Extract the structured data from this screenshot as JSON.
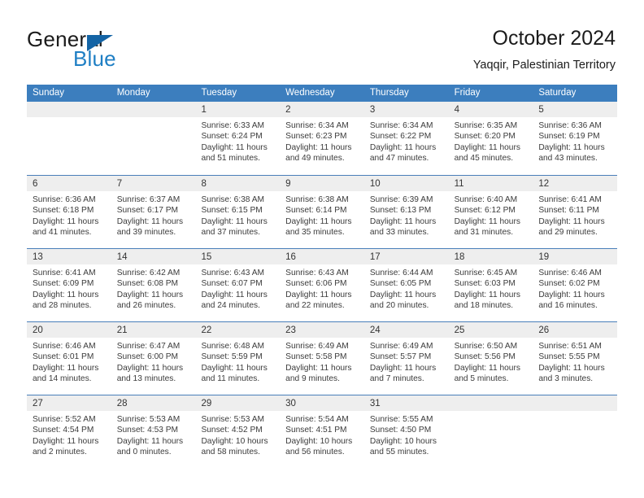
{
  "branding": {
    "name_primary": "General",
    "name_secondary": "Blue",
    "triangle_color": "#1464a5",
    "secondary_color": "#1f7fc4"
  },
  "header": {
    "title": "October 2024",
    "subtitle": "Yaqqir, Palestinian Territory"
  },
  "theme": {
    "header_blue": "#3c7ebe",
    "row_divider_blue": "#4a7fba",
    "day_band_gray": "#eeeeee"
  },
  "weekday_headers": [
    "Sunday",
    "Monday",
    "Tuesday",
    "Wednesday",
    "Thursday",
    "Friday",
    "Saturday"
  ],
  "labels": {
    "sunrise_prefix": "Sunrise:",
    "sunset_prefix": "Sunset:",
    "daylight_prefix": "Daylight:"
  },
  "weeks": [
    [
      {
        "day": "",
        "lines": []
      },
      {
        "day": "",
        "lines": []
      },
      {
        "day": "1",
        "lines": [
          "Sunrise: 6:33 AM",
          "Sunset: 6:24 PM",
          "Daylight: 11 hours",
          "and 51 minutes."
        ]
      },
      {
        "day": "2",
        "lines": [
          "Sunrise: 6:34 AM",
          "Sunset: 6:23 PM",
          "Daylight: 11 hours",
          "and 49 minutes."
        ]
      },
      {
        "day": "3",
        "lines": [
          "Sunrise: 6:34 AM",
          "Sunset: 6:22 PM",
          "Daylight: 11 hours",
          "and 47 minutes."
        ]
      },
      {
        "day": "4",
        "lines": [
          "Sunrise: 6:35 AM",
          "Sunset: 6:20 PM",
          "Daylight: 11 hours",
          "and 45 minutes."
        ]
      },
      {
        "day": "5",
        "lines": [
          "Sunrise: 6:36 AM",
          "Sunset: 6:19 PM",
          "Daylight: 11 hours",
          "and 43 minutes."
        ]
      }
    ],
    [
      {
        "day": "6",
        "lines": [
          "Sunrise: 6:36 AM",
          "Sunset: 6:18 PM",
          "Daylight: 11 hours",
          "and 41 minutes."
        ]
      },
      {
        "day": "7",
        "lines": [
          "Sunrise: 6:37 AM",
          "Sunset: 6:17 PM",
          "Daylight: 11 hours",
          "and 39 minutes."
        ]
      },
      {
        "day": "8",
        "lines": [
          "Sunrise: 6:38 AM",
          "Sunset: 6:15 PM",
          "Daylight: 11 hours",
          "and 37 minutes."
        ]
      },
      {
        "day": "9",
        "lines": [
          "Sunrise: 6:38 AM",
          "Sunset: 6:14 PM",
          "Daylight: 11 hours",
          "and 35 minutes."
        ]
      },
      {
        "day": "10",
        "lines": [
          "Sunrise: 6:39 AM",
          "Sunset: 6:13 PM",
          "Daylight: 11 hours",
          "and 33 minutes."
        ]
      },
      {
        "day": "11",
        "lines": [
          "Sunrise: 6:40 AM",
          "Sunset: 6:12 PM",
          "Daylight: 11 hours",
          "and 31 minutes."
        ]
      },
      {
        "day": "12",
        "lines": [
          "Sunrise: 6:41 AM",
          "Sunset: 6:11 PM",
          "Daylight: 11 hours",
          "and 29 minutes."
        ]
      }
    ],
    [
      {
        "day": "13",
        "lines": [
          "Sunrise: 6:41 AM",
          "Sunset: 6:09 PM",
          "Daylight: 11 hours",
          "and 28 minutes."
        ]
      },
      {
        "day": "14",
        "lines": [
          "Sunrise: 6:42 AM",
          "Sunset: 6:08 PM",
          "Daylight: 11 hours",
          "and 26 minutes."
        ]
      },
      {
        "day": "15",
        "lines": [
          "Sunrise: 6:43 AM",
          "Sunset: 6:07 PM",
          "Daylight: 11 hours",
          "and 24 minutes."
        ]
      },
      {
        "day": "16",
        "lines": [
          "Sunrise: 6:43 AM",
          "Sunset: 6:06 PM",
          "Daylight: 11 hours",
          "and 22 minutes."
        ]
      },
      {
        "day": "17",
        "lines": [
          "Sunrise: 6:44 AM",
          "Sunset: 6:05 PM",
          "Daylight: 11 hours",
          "and 20 minutes."
        ]
      },
      {
        "day": "18",
        "lines": [
          "Sunrise: 6:45 AM",
          "Sunset: 6:03 PM",
          "Daylight: 11 hours",
          "and 18 minutes."
        ]
      },
      {
        "day": "19",
        "lines": [
          "Sunrise: 6:46 AM",
          "Sunset: 6:02 PM",
          "Daylight: 11 hours",
          "and 16 minutes."
        ]
      }
    ],
    [
      {
        "day": "20",
        "lines": [
          "Sunrise: 6:46 AM",
          "Sunset: 6:01 PM",
          "Daylight: 11 hours",
          "and 14 minutes."
        ]
      },
      {
        "day": "21",
        "lines": [
          "Sunrise: 6:47 AM",
          "Sunset: 6:00 PM",
          "Daylight: 11 hours",
          "and 13 minutes."
        ]
      },
      {
        "day": "22",
        "lines": [
          "Sunrise: 6:48 AM",
          "Sunset: 5:59 PM",
          "Daylight: 11 hours",
          "and 11 minutes."
        ]
      },
      {
        "day": "23",
        "lines": [
          "Sunrise: 6:49 AM",
          "Sunset: 5:58 PM",
          "Daylight: 11 hours",
          "and 9 minutes."
        ]
      },
      {
        "day": "24",
        "lines": [
          "Sunrise: 6:49 AM",
          "Sunset: 5:57 PM",
          "Daylight: 11 hours",
          "and 7 minutes."
        ]
      },
      {
        "day": "25",
        "lines": [
          "Sunrise: 6:50 AM",
          "Sunset: 5:56 PM",
          "Daylight: 11 hours",
          "and 5 minutes."
        ]
      },
      {
        "day": "26",
        "lines": [
          "Sunrise: 6:51 AM",
          "Sunset: 5:55 PM",
          "Daylight: 11 hours",
          "and 3 minutes."
        ]
      }
    ],
    [
      {
        "day": "27",
        "lines": [
          "Sunrise: 5:52 AM",
          "Sunset: 4:54 PM",
          "Daylight: 11 hours",
          "and 2 minutes."
        ]
      },
      {
        "day": "28",
        "lines": [
          "Sunrise: 5:53 AM",
          "Sunset: 4:53 PM",
          "Daylight: 11 hours",
          "and 0 minutes."
        ]
      },
      {
        "day": "29",
        "lines": [
          "Sunrise: 5:53 AM",
          "Sunset: 4:52 PM",
          "Daylight: 10 hours",
          "and 58 minutes."
        ]
      },
      {
        "day": "30",
        "lines": [
          "Sunrise: 5:54 AM",
          "Sunset: 4:51 PM",
          "Daylight: 10 hours",
          "and 56 minutes."
        ]
      },
      {
        "day": "31",
        "lines": [
          "Sunrise: 5:55 AM",
          "Sunset: 4:50 PM",
          "Daylight: 10 hours",
          "and 55 minutes."
        ]
      },
      {
        "day": "",
        "lines": []
      },
      {
        "day": "",
        "lines": []
      }
    ]
  ]
}
